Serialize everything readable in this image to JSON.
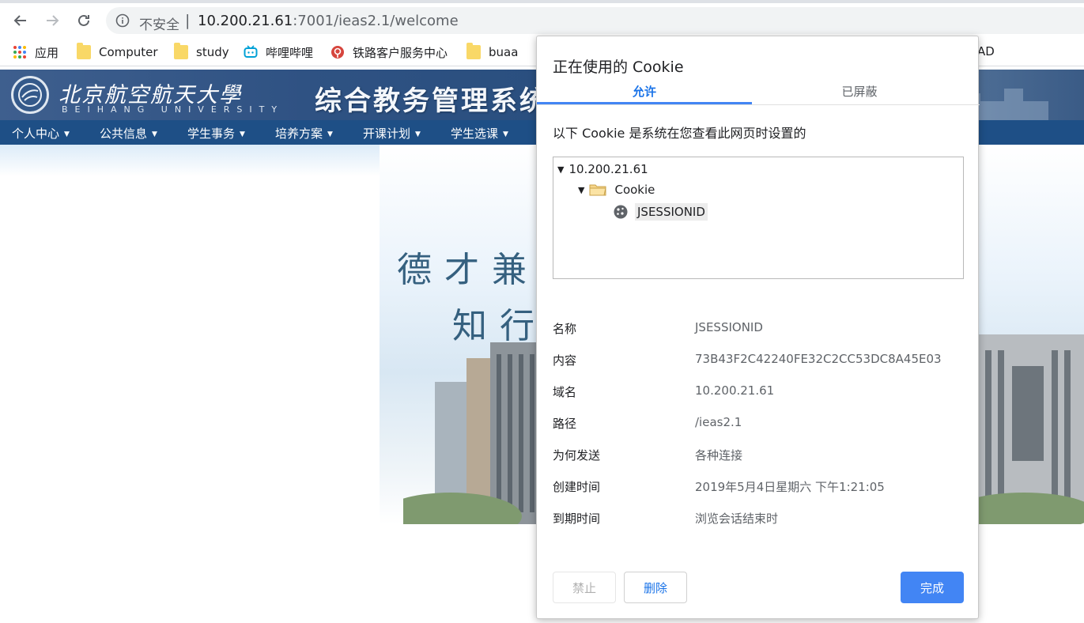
{
  "browser": {
    "security_label": "不安全",
    "separator": "|",
    "url_host": "10.200.21.61",
    "url_rest": ":7001/ieas2.1/welcome",
    "bookmarks": [
      {
        "label": "应用",
        "icon": "apps-grid-icon"
      },
      {
        "label": "Computer",
        "icon": "folder-icon"
      },
      {
        "label": "study",
        "icon": "folder-icon"
      },
      {
        "label": "哔哩哔哩",
        "icon": "bilibili-icon"
      },
      {
        "label": "铁路客户服务中心",
        "icon": "railway-icon"
      },
      {
        "label": "buaa",
        "icon": "folder-icon"
      }
    ],
    "bookmark_tail": "AD"
  },
  "site": {
    "university_name": "北京航空航天大學",
    "university_english": "BEIHANG UNIVERSITY",
    "system_title": "综合教务管理系统",
    "nav": [
      "个人中心",
      "公共信息",
      "学生事务",
      "培养方案",
      "开课计划",
      "学生选课"
    ],
    "motto_line1": "德才兼",
    "motto_line2": "知行"
  },
  "dialog": {
    "title": "正在使用的 Cookie",
    "tabs": {
      "allowed": "允许",
      "blocked": "已屏蔽"
    },
    "description": "以下 Cookie 是系统在您查看此网页时设置的",
    "tree": {
      "domain": "10.200.21.61",
      "folder": "Cookie",
      "cookie": "JSESSIONID"
    },
    "details": [
      {
        "label": "名称",
        "value": "JSESSIONID"
      },
      {
        "label": "内容",
        "value": "73B43F2C42240FE32C2CC53DC8A45E03"
      },
      {
        "label": "域名",
        "value": "10.200.21.61"
      },
      {
        "label": "路径",
        "value": "/ieas2.1"
      },
      {
        "label": "为何发送",
        "value": "各种连接"
      },
      {
        "label": "创建时间",
        "value": "2019年5月4日星期六 下午1:21:05"
      },
      {
        "label": "到期时间",
        "value": "浏览会话结束时"
      }
    ],
    "buttons": {
      "block": "禁止",
      "remove": "删除",
      "done": "完成"
    },
    "colors": {
      "accent": "#4285f4",
      "accent_text": "#1a73e8"
    }
  }
}
